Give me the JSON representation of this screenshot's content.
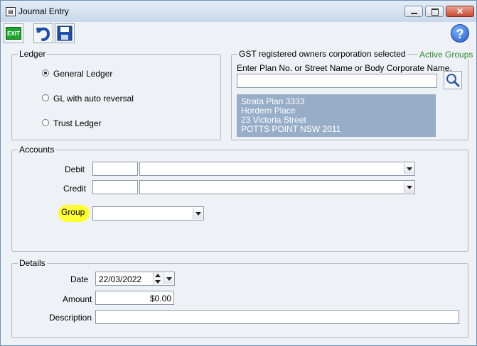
{
  "window": {
    "title": "Journal Entry"
  },
  "toolbar": {
    "exit_label": "EXIT"
  },
  "ledger": {
    "group_label": "Ledger",
    "options": [
      {
        "label": "General Ledger",
        "selected": true
      },
      {
        "label": "GL with auto reversal",
        "selected": false
      },
      {
        "label": "Trust Ledger",
        "selected": false
      }
    ]
  },
  "gst": {
    "header": "GST registered owners corporation selected",
    "active_groups": "Active Groups",
    "search_label": "Enter Plan No. or Street Name or Body Corporate Name.",
    "search_value": "",
    "address": [
      "Strata Plan 3333",
      "Hordern Place",
      "23 Victoria Street",
      "POTTS POINT  NSW  2011"
    ]
  },
  "accounts": {
    "group_label": "Accounts",
    "debit_label": "Debit",
    "credit_label": "Credit",
    "group_field_label": "Group",
    "debit_code": "",
    "debit_name": "",
    "credit_code": "",
    "credit_name": "",
    "group_value": ""
  },
  "details": {
    "group_label": "Details",
    "date_label": "Date",
    "date_value": "22/03/2022",
    "amount_label": "Amount",
    "amount_value": "$0.00",
    "description_label": "Description",
    "description_value": ""
  },
  "colors": {
    "active_groups": "#2e8b2e",
    "address_bg": "#98adc8",
    "highlight": "#ffff33"
  }
}
